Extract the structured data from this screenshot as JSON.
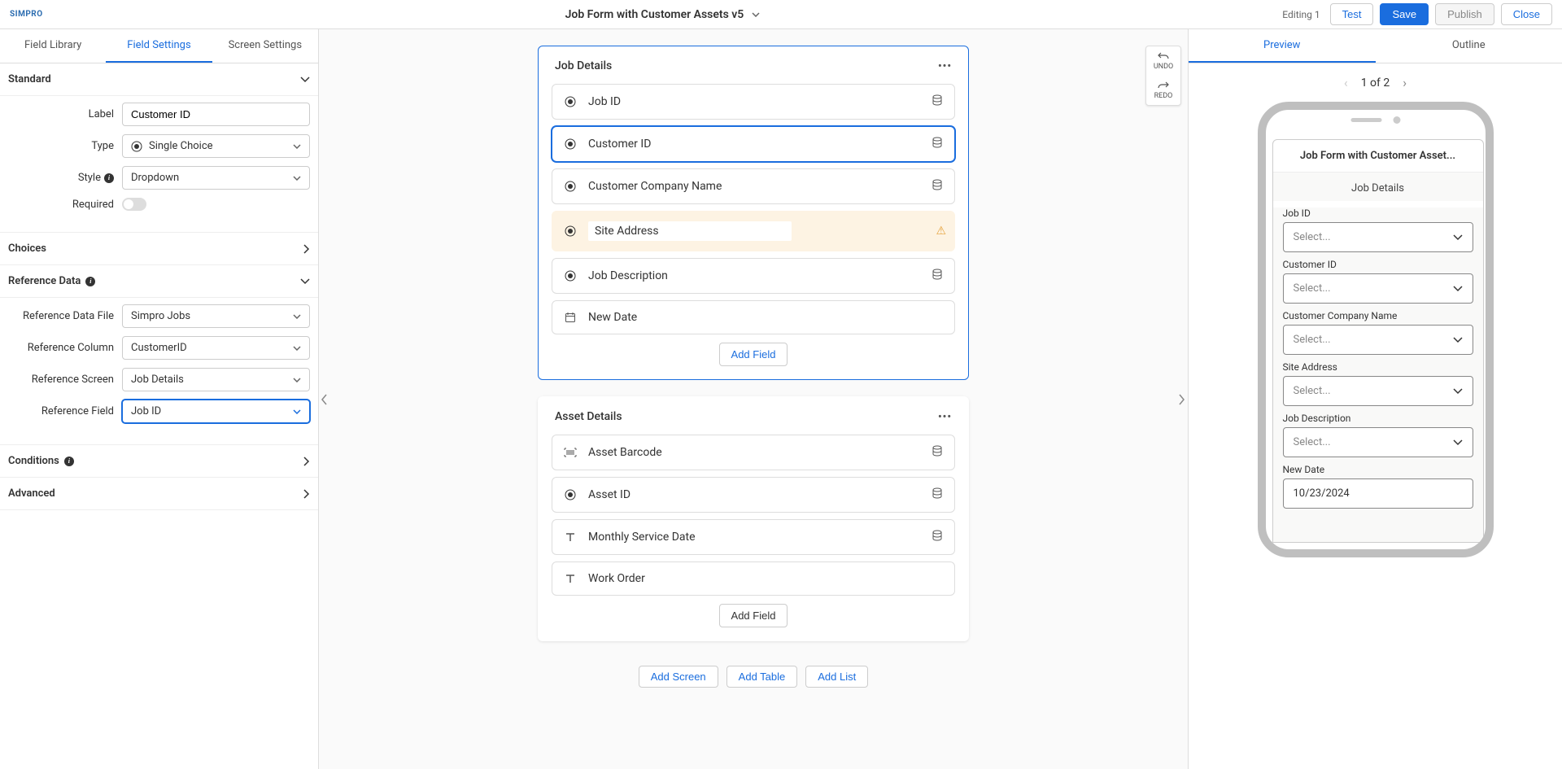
{
  "header": {
    "logo": "SIMPRO",
    "title": "Job Form with Customer Assets v5",
    "editing": "Editing 1",
    "test": "Test",
    "save": "Save",
    "publish": "Publish",
    "close": "Close"
  },
  "leftTabs": {
    "fieldLibrary": "Field Library",
    "fieldSettings": "Field Settings",
    "screenSettings": "Screen Settings"
  },
  "standard": {
    "title": "Standard",
    "labelLabel": "Label",
    "labelValue": "Customer ID",
    "typeLabel": "Type",
    "typeValue": "Single Choice",
    "styleLabel": "Style",
    "styleValue": "Dropdown",
    "requiredLabel": "Required"
  },
  "choices": {
    "title": "Choices"
  },
  "refData": {
    "title": "Reference Data",
    "fileLabel": "Reference Data File",
    "fileValue": "Simpro Jobs",
    "columnLabel": "Reference Column",
    "columnValue": "CustomerID",
    "screenLabel": "Reference Screen",
    "screenValue": "Job Details",
    "fieldLabel": "Reference Field",
    "fieldValue": "Job ID"
  },
  "conditions": {
    "title": "Conditions"
  },
  "advanced": {
    "title": "Advanced"
  },
  "undoRedo": {
    "undo": "UNDO",
    "redo": "REDO"
  },
  "jobDetails": {
    "title": "Job Details",
    "fields": {
      "jobId": "Job ID",
      "customerId": "Customer ID",
      "companyName": "Customer Company Name",
      "siteAddress": "Site Address",
      "jobDesc": "Job Description",
      "newDate": "New Date"
    },
    "addField": "Add Field"
  },
  "assetDetails": {
    "title": "Asset Details",
    "fields": {
      "barcode": "Asset Barcode",
      "assetId": "Asset ID",
      "serviceDate": "Monthly Service Date",
      "workOrder": "Work Order"
    },
    "addField": "Add Field"
  },
  "bottomActions": {
    "addScreen": "Add Screen",
    "addTable": "Add Table",
    "addList": "Add List"
  },
  "rightTabs": {
    "preview": "Preview",
    "outline": "Outline"
  },
  "pager": {
    "text": "1 of 2"
  },
  "phone": {
    "title": "Job Form with Customer Asset...",
    "sectionTitle": "Job Details",
    "selectPlaceholder": "Select...",
    "labels": {
      "jobId": "Job ID",
      "customerId": "Customer ID",
      "companyName": "Customer Company Name",
      "siteAddress": "Site Address",
      "jobDesc": "Job Description",
      "newDate": "New Date"
    },
    "dateValue": "10/23/2024"
  }
}
